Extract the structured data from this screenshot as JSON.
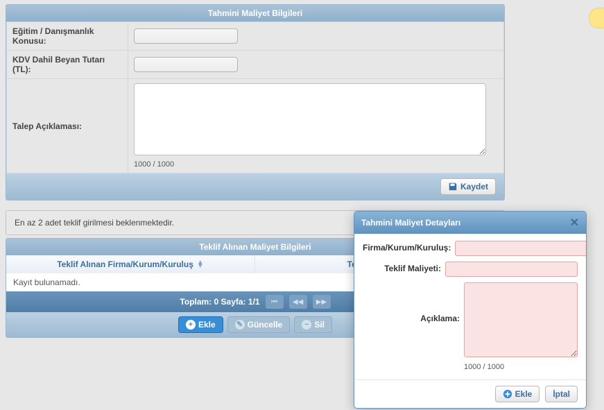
{
  "top_panel": {
    "title": "Tahmini Maliyet Bilgileri",
    "fields": {
      "topic_label": "Eğitim / Danışmanlık Konusu:",
      "topic_value": "",
      "amount_label": "KDV Dahil Beyan Tutarı (TL):",
      "amount_value": "",
      "desc_label": "Talep Açıklaması:",
      "desc_value": "",
      "desc_count": "1000 / 1000"
    },
    "save_label": "Kaydet"
  },
  "warning": "En az 2 adet teklif girilmesi beklenmektedir.",
  "grid": {
    "title": "Teklif Alınan Maliyet Bilgileri",
    "col1": "Teklif Alınan Firma/Kurum/Kuruluş",
    "col2": "Teklif Maliyeti",
    "empty": "Kayıt bulunamadı.",
    "pager": "Toplam: 0  Sayfa: 1/1",
    "btn_add": "Ekle",
    "btn_update": "Güncelle",
    "btn_delete": "Sil"
  },
  "dialog": {
    "title": "Tahmini Maliyet Detayları",
    "firm_label": "Firma/Kurum/Kuruluş:",
    "firm_value": "",
    "cost_label": "Teklif Maliyeti:",
    "cost_value": "",
    "desc_label": "Açıklama:",
    "desc_value": "",
    "desc_count": "1000 / 1000",
    "btn_add": "Ekle",
    "btn_cancel": "İptal"
  }
}
